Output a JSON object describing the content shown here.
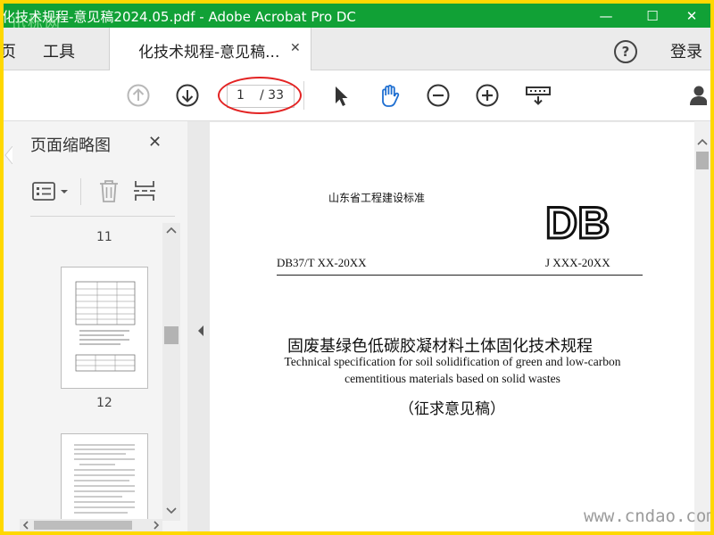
{
  "window": {
    "title": "化技术规程-意见稿2024.05.pdf - Adobe Acrobat Pro DC",
    "watermark_top": "迅标网",
    "controls": {
      "minimize": "—",
      "maximize": "☐",
      "close": "✕"
    }
  },
  "tabs": {
    "left_partial": "页",
    "tools": "工具",
    "active_doc": "化技术规程-意见稿...",
    "close_glyph": "✕",
    "help": "?",
    "login": "登录"
  },
  "toolbar": {
    "current_page": "1",
    "total_pages": "/ 33"
  },
  "sidebar": {
    "title": "页面缩略图",
    "close_glyph": "✕",
    "pages": [
      "11",
      "12"
    ]
  },
  "document": {
    "standard_org": "山东省工程建设标准",
    "logo": "DB",
    "code_left": "DB37/T XX-20XX",
    "code_right": "J XXX-20XX",
    "title_cn": "固废基绿色低碳胶凝材料土体固化技术规程",
    "title_en_1": "Technical specification for soil solidification of green and low-carbon",
    "title_en_2": "cementitious materials based on solid wastes",
    "draft_label": "（征求意见稿）"
  },
  "footer_watermark": "www.cndao.com",
  "colors": {
    "titlebar": "#11a136",
    "frame": "#ffd800",
    "highlight_oval": "#e32323",
    "hand_tool": "#1f6fd1"
  },
  "icons": [
    "prev-page-icon",
    "next-page-icon",
    "select-arrow-icon",
    "hand-tool-icon",
    "zoom-out-icon",
    "zoom-in-icon",
    "page-display-icon",
    "user-icon",
    "options-icon",
    "trash-icon",
    "insert-page-icon"
  ]
}
